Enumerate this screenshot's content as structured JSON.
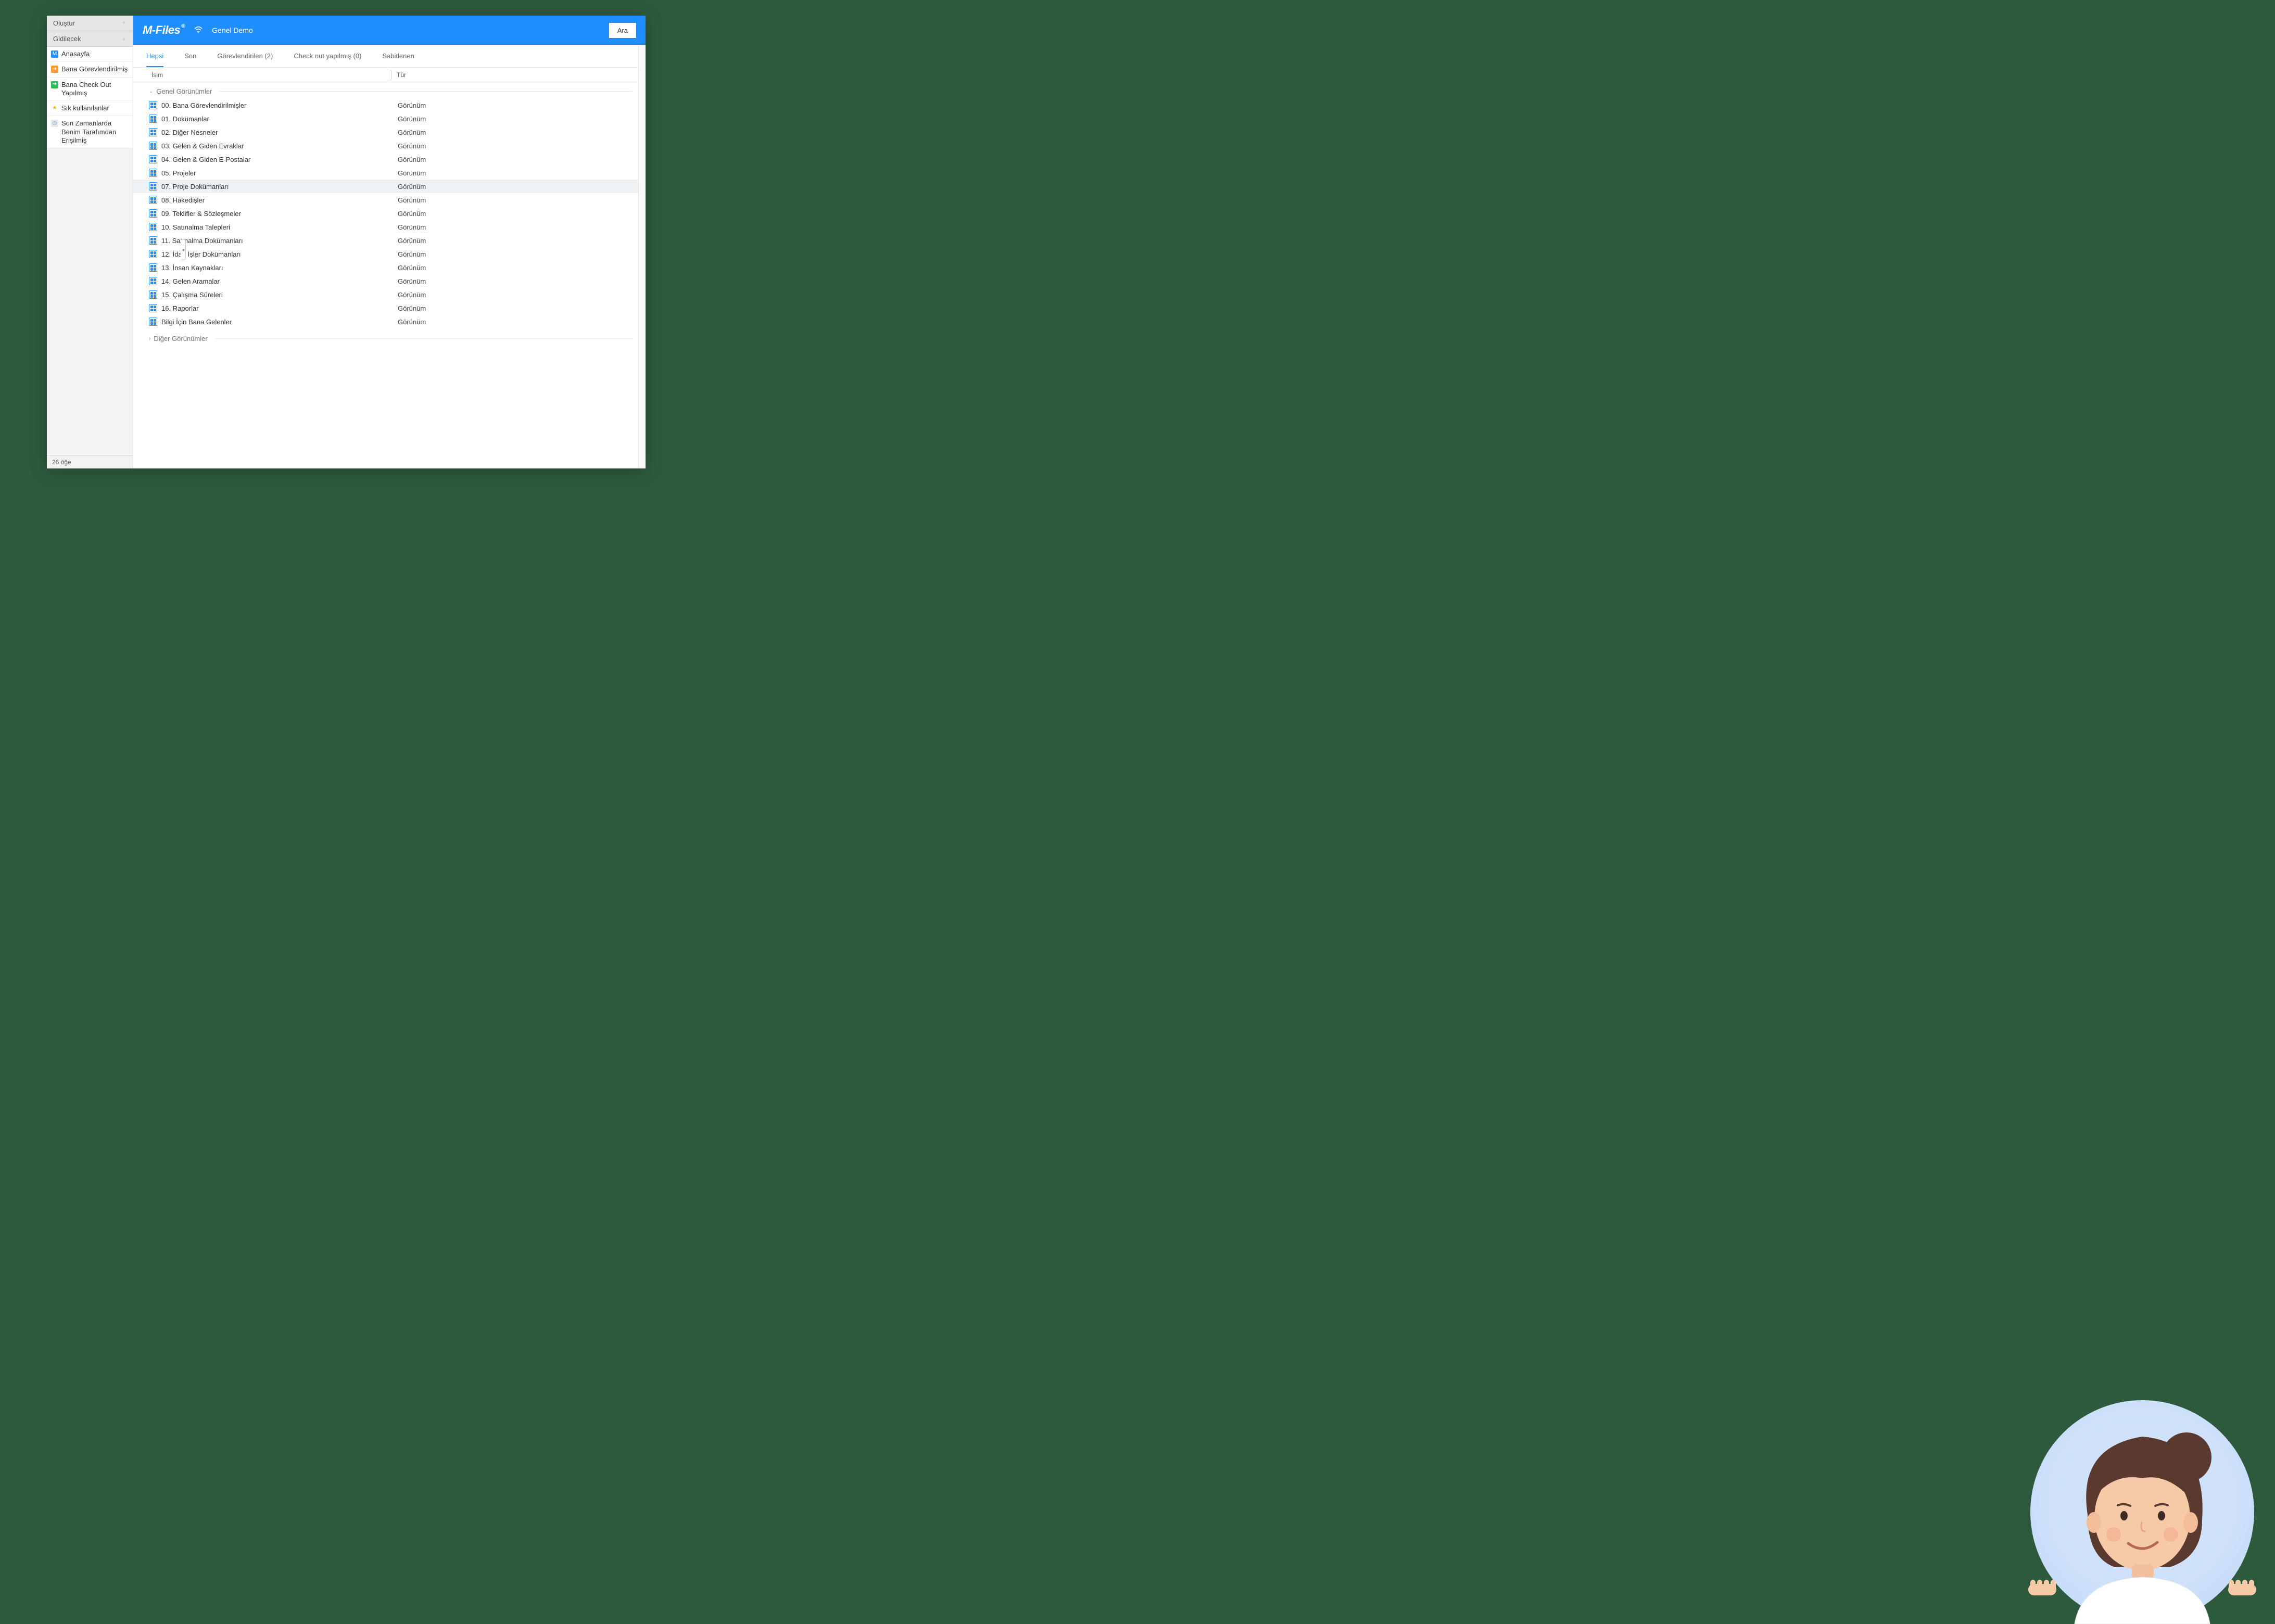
{
  "sidebar": {
    "create_label": "Oluştur",
    "navigate_label": "Gidilecek",
    "items": [
      {
        "label": "Anasayfa",
        "icon": "home"
      },
      {
        "label": "Bana Görevlendirilmiş",
        "icon": "assigned"
      },
      {
        "label": "Bana Check Out Yapılmış",
        "icon": "checked-out"
      },
      {
        "label": "Sık kullanılanlar",
        "icon": "star"
      },
      {
        "label": "Son Zamanlarda Benim Tarafımdan Erişilmiş",
        "icon": "recent"
      }
    ],
    "footer": "26 öğe"
  },
  "header": {
    "logo": "M-Files",
    "title": "Genel Demo",
    "search_label": "Ara"
  },
  "tabs": [
    {
      "label": "Hepsi",
      "active": true
    },
    {
      "label": "Son"
    },
    {
      "label": "Görevlendirilen (2)"
    },
    {
      "label": "Check out yapılmış (0)"
    },
    {
      "label": "Sabitlenen"
    }
  ],
  "columns": {
    "name": "İsim",
    "type": "Tür"
  },
  "groups": {
    "general_label": "Genel Görünümler",
    "other_label": "Diğer Görünümler",
    "type_value": "Görünüm",
    "items": [
      "00. Bana Görevlendirilmişler",
      "01. Dokümanlar",
      "02. Diğer Nesneler",
      "03. Gelen & Giden Evraklar",
      "04. Gelen & Giden E-Postalar",
      "05. Projeler",
      "07. Proje Dokümanları",
      "08. Hakedişler",
      "09. Teklifler & Sözleşmeler",
      "10. Satınalma Talepleri",
      "11. Satınalma Dokümanları",
      "12. İdari İşler Dokümanları",
      "13. İnsan Kaynakları",
      "14. Gelen Aramalar",
      "15. Çalışma Süreleri",
      "16. Raporlar",
      "Bilgi İçin Bana Gelenler"
    ],
    "selected_index": 6
  },
  "colors": {
    "brand": "#1f8fff"
  }
}
